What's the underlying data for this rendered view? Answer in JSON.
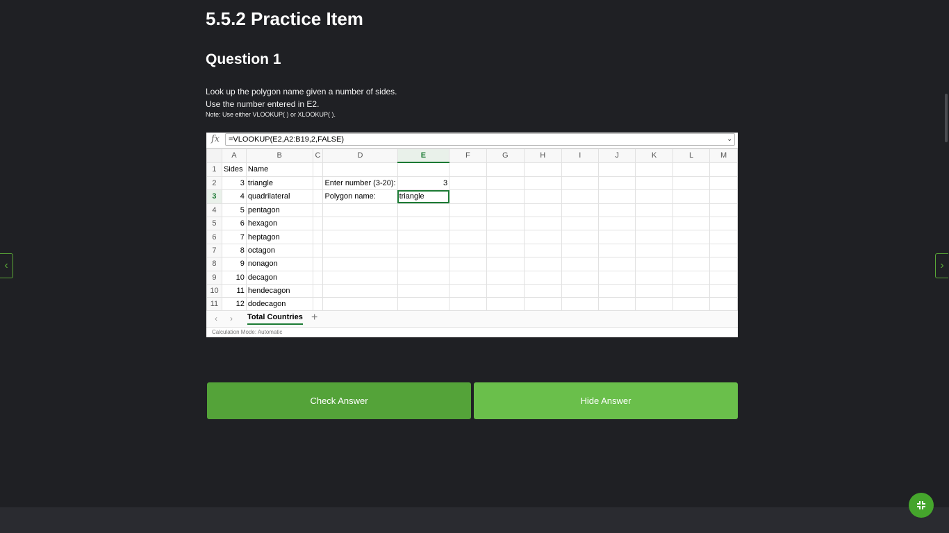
{
  "page": {
    "title": "5.5.2 Practice Item",
    "question_title": "Question 1",
    "instructions": [
      "Look up the polygon name given a number of sides.",
      "Use the number entered in E2."
    ],
    "note": "Note: Use either VLOOKUP( ) or XLOOKUP( )."
  },
  "nav": {
    "prev_icon": "‹",
    "next_icon": "›"
  },
  "spreadsheet": {
    "fx_label": "fx",
    "formula": "=VLOOKUP(E2,A2:B19,2,FALSE)",
    "columns": [
      "A",
      "B",
      "C",
      "D",
      "E",
      "F",
      "G",
      "H",
      "I",
      "J",
      "K",
      "L",
      "M"
    ],
    "selected_column": "E",
    "selected_row": "3",
    "rows": [
      {
        "n": "1",
        "a": "Sides",
        "b": "Name",
        "d": "",
        "e": ""
      },
      {
        "n": "2",
        "a": "3",
        "b": "triangle",
        "d": "Enter number (3-20):",
        "e": "3"
      },
      {
        "n": "3",
        "a": "4",
        "b": "quadrilateral",
        "d": "Polygon name:",
        "e": "triangle"
      },
      {
        "n": "4",
        "a": "5",
        "b": "pentagon",
        "d": "",
        "e": ""
      },
      {
        "n": "5",
        "a": "6",
        "b": "hexagon",
        "d": "",
        "e": ""
      },
      {
        "n": "6",
        "a": "7",
        "b": "heptagon",
        "d": "",
        "e": ""
      },
      {
        "n": "7",
        "a": "8",
        "b": "octagon",
        "d": "",
        "e": ""
      },
      {
        "n": "8",
        "a": "9",
        "b": "nonagon",
        "d": "",
        "e": ""
      },
      {
        "n": "9",
        "a": "10",
        "b": "decagon",
        "d": "",
        "e": ""
      },
      {
        "n": "10",
        "a": "11",
        "b": "hendecagon",
        "d": "",
        "e": ""
      },
      {
        "n": "11",
        "a": "12",
        "b": "dodecagon",
        "d": "",
        "e": ""
      }
    ],
    "sheet_tab": "Total Countries",
    "add_sheet": "+",
    "tab_prev": "‹",
    "tab_next": "›",
    "status": "Calculation Mode: Automatic"
  },
  "buttons": {
    "check": "Check Answer",
    "hide": "Hide Answer"
  },
  "colors": {
    "accent": "#54a339",
    "accent_light": "#6abf4b",
    "background": "#1f2024"
  },
  "icons": {
    "fab": "collapse-icon"
  }
}
